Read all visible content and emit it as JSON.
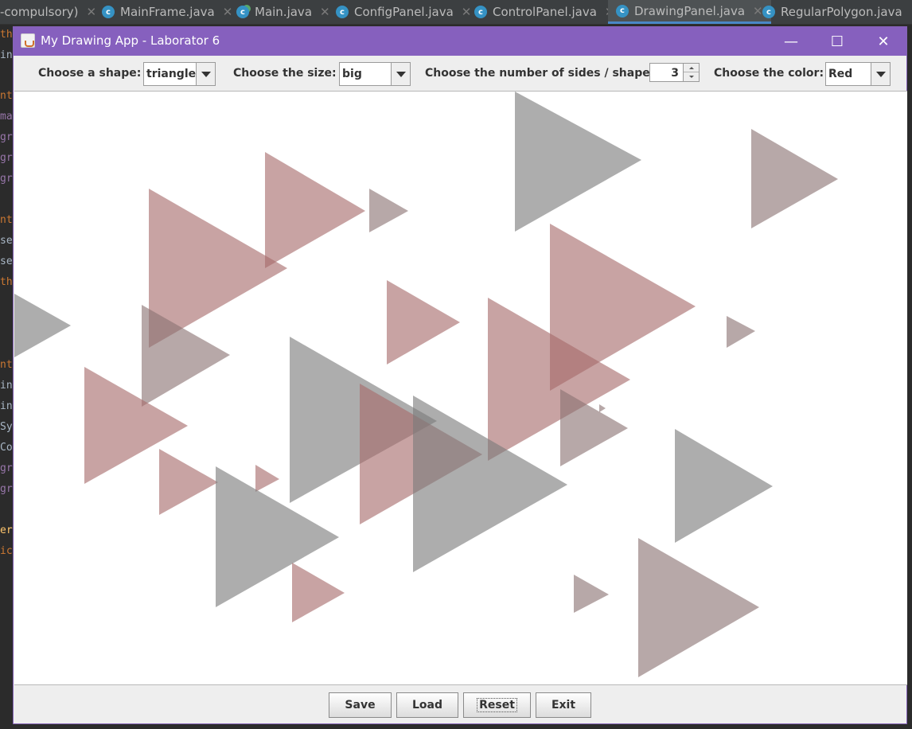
{
  "ide": {
    "tabs": [
      {
        "label": "-compulsory)",
        "icon": "none"
      },
      {
        "label": "MainFrame.java",
        "icon": "class-icon"
      },
      {
        "label": "Main.java",
        "icon": "runnable-class-icon"
      },
      {
        "label": "ConfigPanel.java",
        "icon": "class-icon"
      },
      {
        "label": "ControlPanel.java",
        "icon": "class-icon"
      },
      {
        "label": "DrawingPanel.java",
        "icon": "class-icon",
        "active": true
      },
      {
        "label": "RegularPolygon.java",
        "icon": "class-icon"
      }
    ],
    "close_glyph": "✕",
    "class_glyph": "c",
    "gutter_fragments": [
      "th",
      "in",
      "nt",
      "ma",
      "gr",
      "gr",
      "gr",
      "nt",
      "se",
      "se",
      "th",
      "nt",
      "in",
      "in",
      "Sy",
      "Co",
      "gr",
      "gr",
      "er",
      "ic"
    ],
    "colors": {
      "background": "#2b2b2b",
      "tabbar": "#3c3f41",
      "active_tab": "#4e5254",
      "class_icon": "#3592c4"
    }
  },
  "window": {
    "title": "My Drawing App - Laborator 6",
    "minimize_glyph": "—",
    "maximize_glyph": "☐",
    "close_glyph": "✕",
    "title_color": "#8660be"
  },
  "config": {
    "shape_label": "Choose a shape:",
    "shape_value": "triangle",
    "size_label": "Choose the size:",
    "size_value": "big",
    "sides_label": "Choose the number of sides / shapes:",
    "sides_value": "3",
    "color_label": "Choose the color:",
    "color_value": "Red"
  },
  "canvas": {
    "shapes": "triangles",
    "colors": {
      "reddish": "#a66a6a",
      "gray": "#7a7a7a",
      "mauve": "#8a7272"
    }
  },
  "controls": {
    "save": "Save",
    "load": "Load",
    "reset": "Reset",
    "exit": "Exit"
  }
}
